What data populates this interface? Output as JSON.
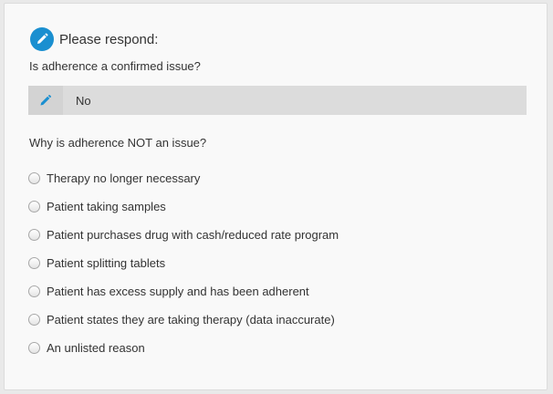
{
  "header": {
    "title": "Please respond:",
    "icon": "pencil-icon",
    "icon_color": "#1a8fd0"
  },
  "question1": {
    "text": "Is adherence a confirmed issue?",
    "answer": "No",
    "answer_icon": "pencil-icon",
    "answer_icon_color": "#1a8fd0"
  },
  "question2": {
    "text": "Why is adherence NOT an issue?",
    "options": [
      "Therapy no longer necessary",
      "Patient taking samples",
      "Patient purchases drug with cash/reduced rate program",
      "Patient splitting tablets",
      "Patient has excess supply and has been adherent",
      "Patient states they are taking therapy (data inaccurate)",
      "An unlisted reason"
    ]
  }
}
